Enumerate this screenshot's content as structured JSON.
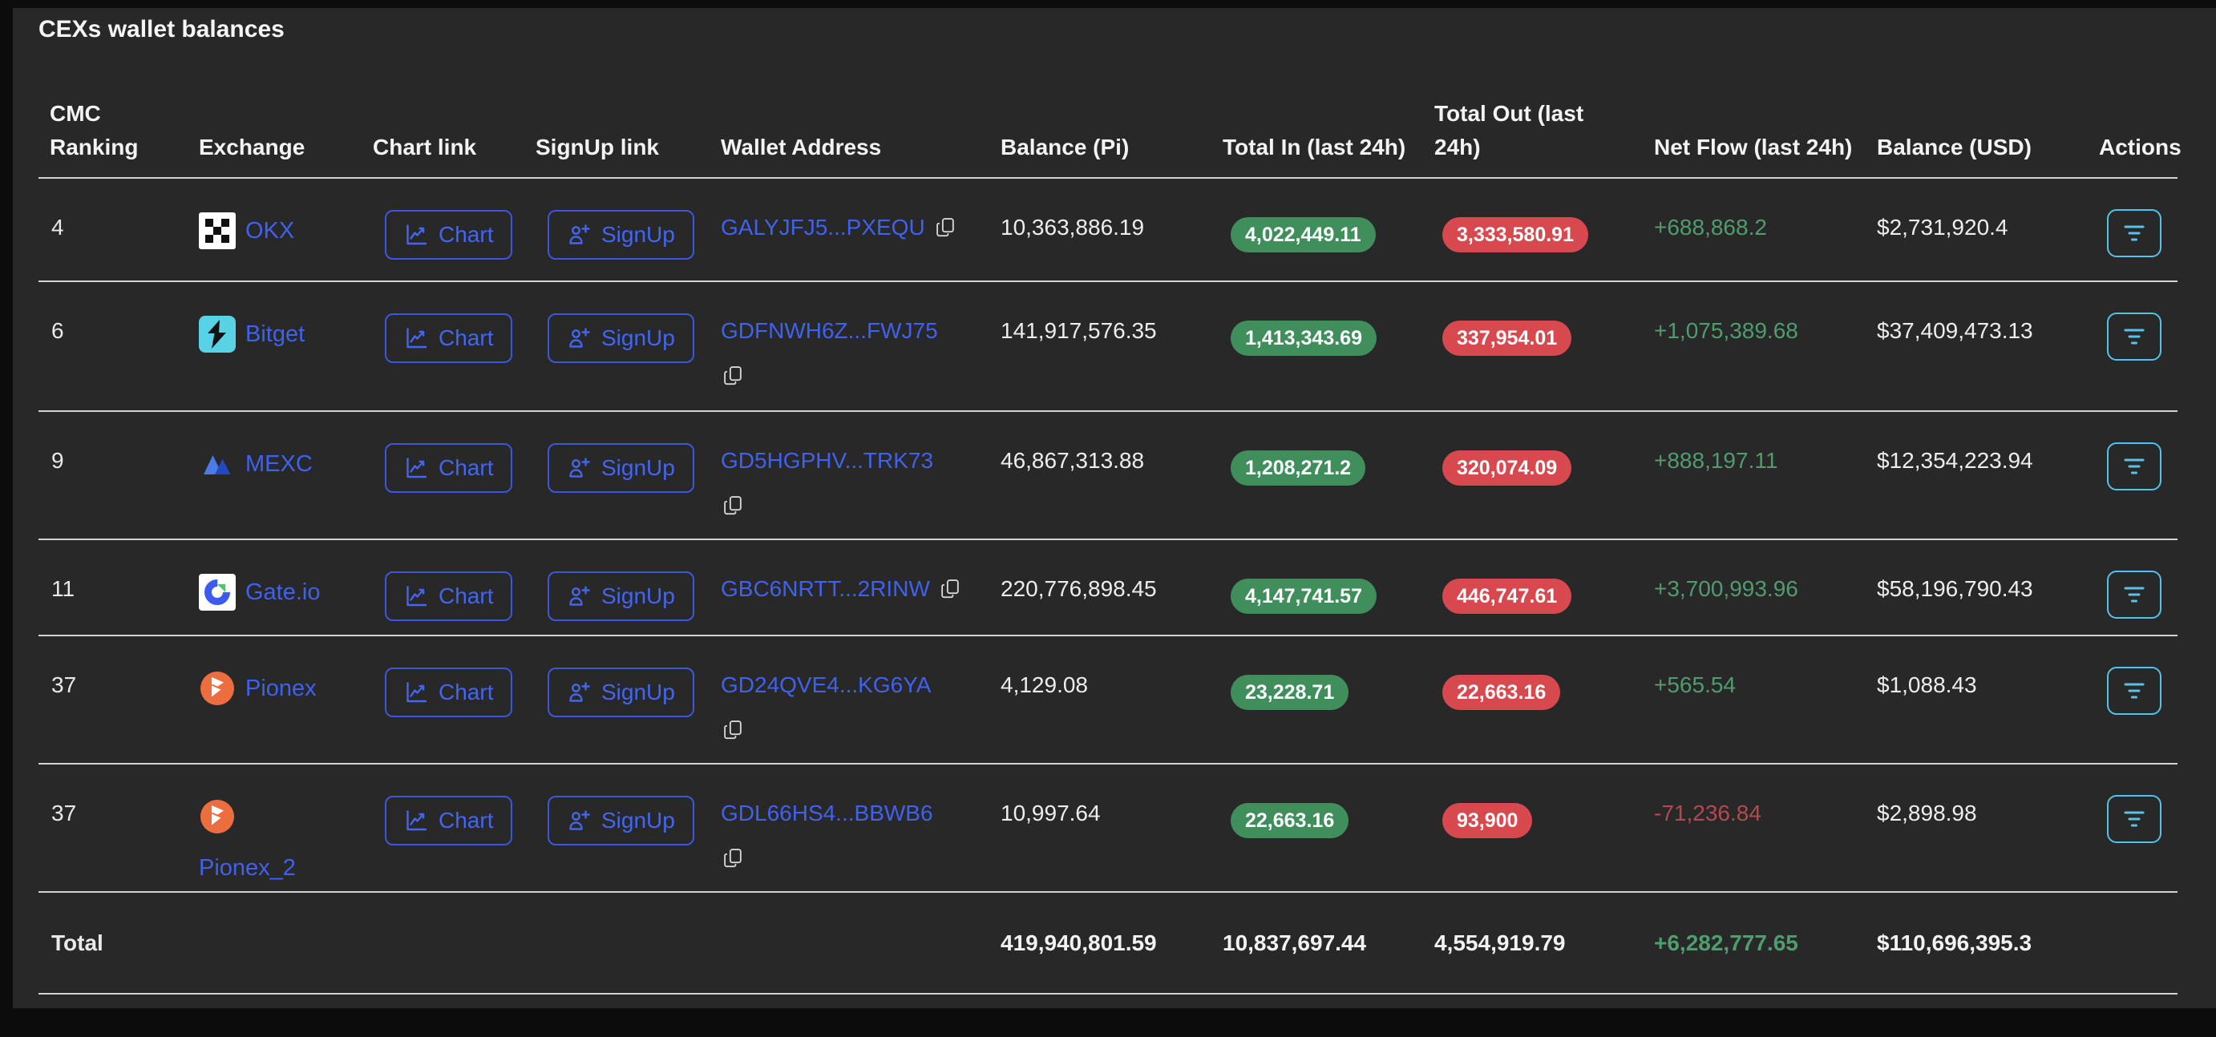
{
  "title": "CEXs wallet balances",
  "table": {
    "columns": [
      "CMC Ranking",
      "Exchange",
      "Chart link",
      "SignUp link",
      "Wallet Address",
      "Balance (Pi)",
      "Total In (last 24h)",
      "Total Out (last 24h)",
      "Net Flow (last 24h)",
      "Balance (USD)",
      "Actions"
    ],
    "buttons": {
      "chart": "Chart",
      "signup": "SignUp"
    },
    "rows": [
      {
        "cmc_ranking": "4",
        "exchange": "OKX",
        "logo": "okx",
        "name_wrapped": false,
        "wallet_address": "GALYJFJ5...PXEQU",
        "copy_wrapped": false,
        "balance_pi": "10,363,886.19",
        "total_in": "4,022,449.11",
        "total_out": "3,333,580.91",
        "net_flow": "+688,868.2",
        "net_flow_positive": true,
        "balance_usd": "$2,731,920.4"
      },
      {
        "cmc_ranking": "6",
        "exchange": "Bitget",
        "logo": "bitget",
        "name_wrapped": false,
        "wallet_address": "GDFNWH6Z...FWJ75",
        "copy_wrapped": true,
        "balance_pi": "141,917,576.35",
        "total_in": "1,413,343.69",
        "total_out": "337,954.01",
        "net_flow": "+1,075,389.68",
        "net_flow_positive": true,
        "balance_usd": "$37,409,473.13"
      },
      {
        "cmc_ranking": "9",
        "exchange": "MEXC",
        "logo": "mexc",
        "name_wrapped": false,
        "wallet_address": "GD5HGPHV...TRK73",
        "copy_wrapped": true,
        "balance_pi": "46,867,313.88",
        "total_in": "1,208,271.2",
        "total_out": "320,074.09",
        "net_flow": "+888,197.11",
        "net_flow_positive": true,
        "balance_usd": "$12,354,223.94"
      },
      {
        "cmc_ranking": "11",
        "exchange": "Gate.io",
        "logo": "gate",
        "name_wrapped": false,
        "wallet_address": "GBC6NRTT...2RINW",
        "copy_wrapped": false,
        "balance_pi": "220,776,898.45",
        "total_in": "4,147,741.57",
        "total_out": "446,747.61",
        "net_flow": "+3,700,993.96",
        "net_flow_positive": true,
        "balance_usd": "$58,196,790.43"
      },
      {
        "cmc_ranking": "37",
        "exchange": "Pionex",
        "logo": "pionex",
        "name_wrapped": false,
        "wallet_address": "GD24QVE4...KG6YA",
        "copy_wrapped": true,
        "balance_pi": "4,129.08",
        "total_in": "23,228.71",
        "total_out": "22,663.16",
        "net_flow": "+565.54",
        "net_flow_positive": true,
        "balance_usd": "$1,088.43"
      },
      {
        "cmc_ranking": "37",
        "exchange": "Pionex_2",
        "logo": "pionex",
        "name_wrapped": true,
        "wallet_address": "GDL66HS4...BBWB6",
        "copy_wrapped": true,
        "balance_pi": "10,997.64",
        "total_in": "22,663.16",
        "total_out": "93,900",
        "net_flow": "-71,236.84",
        "net_flow_positive": false,
        "balance_usd": "$2,898.98"
      }
    ],
    "total": {
      "label": "Total",
      "balance_pi": "419,940,801.59",
      "total_in": "10,837,697.44",
      "total_out": "4,554,919.79",
      "net_flow": "+6,282,777.65",
      "net_flow_positive": true,
      "balance_usd": "$110,696,395.3"
    }
  },
  "colors": {
    "background": "#282828",
    "link_blue": "#3f62ee",
    "pill_green": "#3f8e5c",
    "pill_red": "#d8494f",
    "netflow_green": "#4f9d6e",
    "netflow_red": "#b4494f",
    "action_cyan": "#54c2ea",
    "row_border": "#d2d2d2"
  }
}
